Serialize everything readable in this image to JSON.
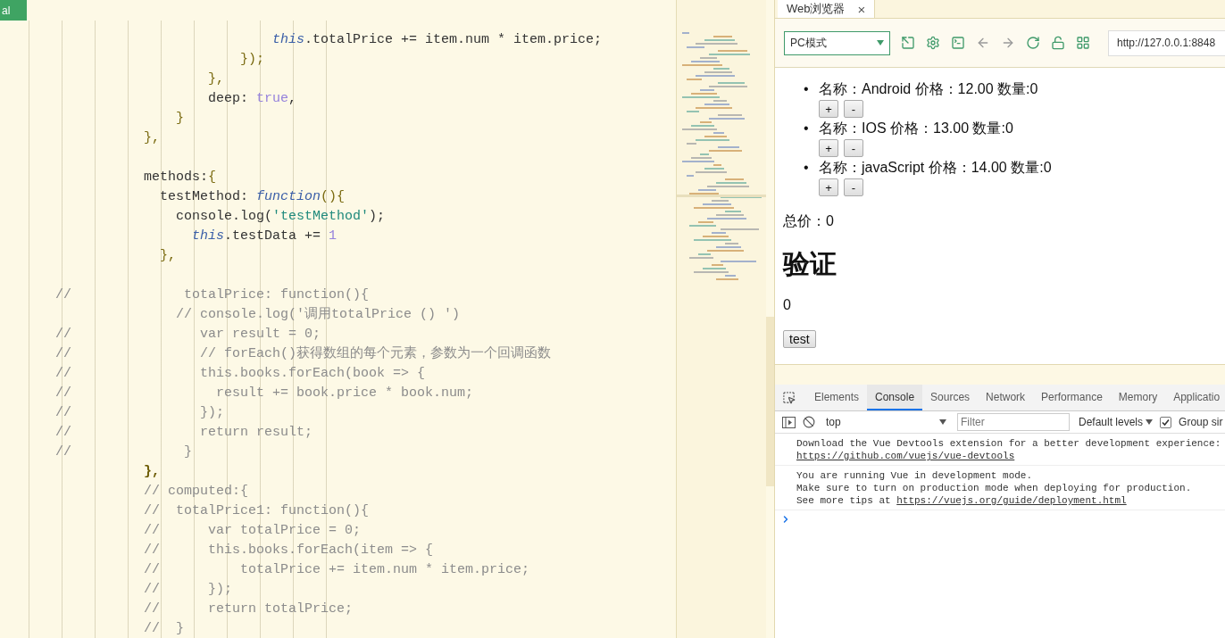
{
  "editor": {
    "mode_tag": "al",
    "lines": [
      {
        "kind": "code",
        "tokens": [
          {
            "kind": "kw",
            "text": "                                this"
          },
          {
            "kind": "plain",
            "text": ".totalPrice += item.num * item.price;"
          }
        ]
      },
      {
        "kind": "code",
        "tokens": [
          {
            "kind": "punct",
            "text": "                            });"
          }
        ]
      },
      {
        "kind": "code",
        "tokens": [
          {
            "kind": "punct",
            "text": "                        },"
          }
        ]
      },
      {
        "kind": "code",
        "tokens": [
          {
            "kind": "plain",
            "text": "                        deep: "
          },
          {
            "kind": "num",
            "text": "true"
          },
          {
            "kind": "plain",
            "text": ","
          }
        ]
      },
      {
        "kind": "code",
        "tokens": [
          {
            "kind": "punct",
            "text": "                    }"
          }
        ]
      },
      {
        "kind": "code",
        "tokens": [
          {
            "kind": "punct",
            "text": "                },"
          }
        ]
      },
      {
        "kind": "blank"
      },
      {
        "kind": "code",
        "tokens": [
          {
            "kind": "plain",
            "text": "                methods:"
          },
          {
            "kind": "punct",
            "text": "{"
          }
        ]
      },
      {
        "kind": "code",
        "tokens": [
          {
            "kind": "plain",
            "text": "                  testMethod: "
          },
          {
            "kind": "kw",
            "text": "function"
          },
          {
            "kind": "punct",
            "text": "(){"
          }
        ]
      },
      {
        "kind": "code",
        "tokens": [
          {
            "kind": "plain",
            "text": "                    console.log("
          },
          {
            "kind": "str",
            "text": "'testMethod'"
          },
          {
            "kind": "plain",
            "text": ");"
          }
        ]
      },
      {
        "kind": "code",
        "tokens": [
          {
            "kind": "kw",
            "text": "                      this"
          },
          {
            "kind": "plain",
            "text": ".testData += "
          },
          {
            "kind": "num",
            "text": "1"
          }
        ]
      },
      {
        "kind": "code",
        "tokens": [
          {
            "kind": "punct",
            "text": "                  },"
          }
        ]
      },
      {
        "kind": "blank"
      },
      {
        "kind": "code",
        "tokens": [
          {
            "kind": "comment",
            "text": "     //              totalPrice: function(){"
          }
        ]
      },
      {
        "kind": "code",
        "tokens": [
          {
            "kind": "comment",
            "text": "                    // console.log('调用totalPrice () ')"
          }
        ]
      },
      {
        "kind": "code",
        "tokens": [
          {
            "kind": "comment",
            "text": "     //                var result = 0;"
          }
        ]
      },
      {
        "kind": "code",
        "tokens": [
          {
            "kind": "comment",
            "text": "     //                // forEach()获得数组的每个元素，参数为一个回调函数"
          }
        ]
      },
      {
        "kind": "code",
        "tokens": [
          {
            "kind": "comment",
            "text": "     //                this.books.forEach(book => {"
          }
        ]
      },
      {
        "kind": "code",
        "tokens": [
          {
            "kind": "comment",
            "text": "     //                  result += book.price * book.num;"
          }
        ]
      },
      {
        "kind": "code",
        "tokens": [
          {
            "kind": "comment",
            "text": "     //                });"
          }
        ]
      },
      {
        "kind": "code",
        "tokens": [
          {
            "kind": "comment",
            "text": "     //                return result;"
          }
        ]
      },
      {
        "kind": "code",
        "tokens": [
          {
            "kind": "comment",
            "text": "     //              }"
          }
        ]
      },
      {
        "kind": "code",
        "tokens": [
          {
            "kind": "strong",
            "text": "                },"
          }
        ]
      },
      {
        "kind": "code",
        "tokens": [
          {
            "kind": "comment",
            "text": "                // computed:{"
          }
        ]
      },
      {
        "kind": "code",
        "tokens": [
          {
            "kind": "comment",
            "text": "                //  totalPrice1: function(){"
          }
        ]
      },
      {
        "kind": "code",
        "tokens": [
          {
            "kind": "comment",
            "text": "                //      var totalPrice = 0;"
          }
        ]
      },
      {
        "kind": "code",
        "tokens": [
          {
            "kind": "comment",
            "text": "                //      this.books.forEach(item => {"
          }
        ]
      },
      {
        "kind": "code",
        "tokens": [
          {
            "kind": "comment",
            "text": "                //          totalPrice += item.num * item.price;"
          }
        ]
      },
      {
        "kind": "code",
        "tokens": [
          {
            "kind": "comment",
            "text": "                //      });"
          }
        ]
      },
      {
        "kind": "code",
        "tokens": [
          {
            "kind": "comment",
            "text": "                //      return totalPrice;"
          }
        ]
      },
      {
        "kind": "code",
        "tokens": [
          {
            "kind": "comment",
            "text": "                //  }"
          }
        ]
      }
    ]
  },
  "browser": {
    "tab": {
      "title": "Web浏览器",
      "close": "×"
    },
    "toolbar": {
      "mode_select": "PC模式",
      "url": "http://127.0.0.1:8848"
    },
    "page": {
      "items": [
        {
          "bullet": "•",
          "text": "名称：Android 价格：12.00 数量:0",
          "buttons": [
            "+",
            "-"
          ]
        },
        {
          "bullet": "•",
          "text": "名称：IOS 价格：13.00 数量:0",
          "buttons": [
            "+",
            "-"
          ]
        },
        {
          "bullet": "•",
          "text": "名称：javaScript 价格：14.00 数量:0",
          "buttons": [
            "+",
            "-"
          ]
        }
      ],
      "total": "总价：0",
      "heading": "验证",
      "value": "0",
      "button": "test"
    }
  },
  "devtools": {
    "tabs": [
      {
        "label": "Elements",
        "selected": false
      },
      {
        "label": "Console",
        "selected": true
      },
      {
        "label": "Sources",
        "selected": false
      },
      {
        "label": "Network",
        "selected": false
      },
      {
        "label": "Performance",
        "selected": false
      },
      {
        "label": "Memory",
        "selected": false
      },
      {
        "label": "Applicatio",
        "selected": false
      }
    ],
    "context": "top",
    "filter_placeholder": "Filter",
    "levels": "Default levels",
    "group_similar": {
      "label": "Group sir",
      "checked": true
    },
    "messages": [
      {
        "lines": [
          {
            "text": "Download the Vue Devtools extension for a better development experience:"
          },
          {
            "link": "https://github.com/vuejs/vue-devtools"
          }
        ]
      },
      {
        "lines": [
          {
            "text": "You are running Vue in development mode."
          },
          {
            "text": "Make sure to turn on production mode when deploying for production."
          },
          {
            "text": "See more tips at ",
            "link": "https://vuejs.org/guide/deployment.html"
          }
        ]
      }
    ]
  }
}
